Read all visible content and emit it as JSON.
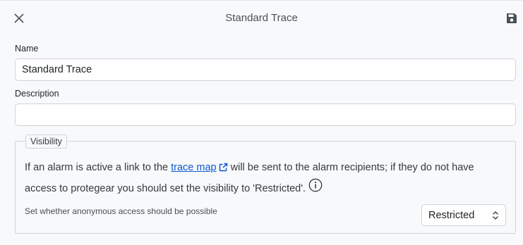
{
  "header": {
    "title": "Standard Trace",
    "close_icon": "close-icon",
    "save_icon": "floppy-disk-icon"
  },
  "form": {
    "name_label": "Name",
    "name_value": "Standard Trace",
    "description_label": "Description",
    "description_value": ""
  },
  "visibility": {
    "legend": "Visibility",
    "text_before_link": "If an alarm is active a link to the ",
    "link_text": "trace map",
    "text_after_link": " will be sent to the alarm recipients; if they do not have access to protegear you should set the visibility to 'Restricted'.",
    "anonymous_label": "Set whether anonymous access should be possible",
    "selected_option": "Restricted",
    "link_color": "#0b57d0"
  }
}
